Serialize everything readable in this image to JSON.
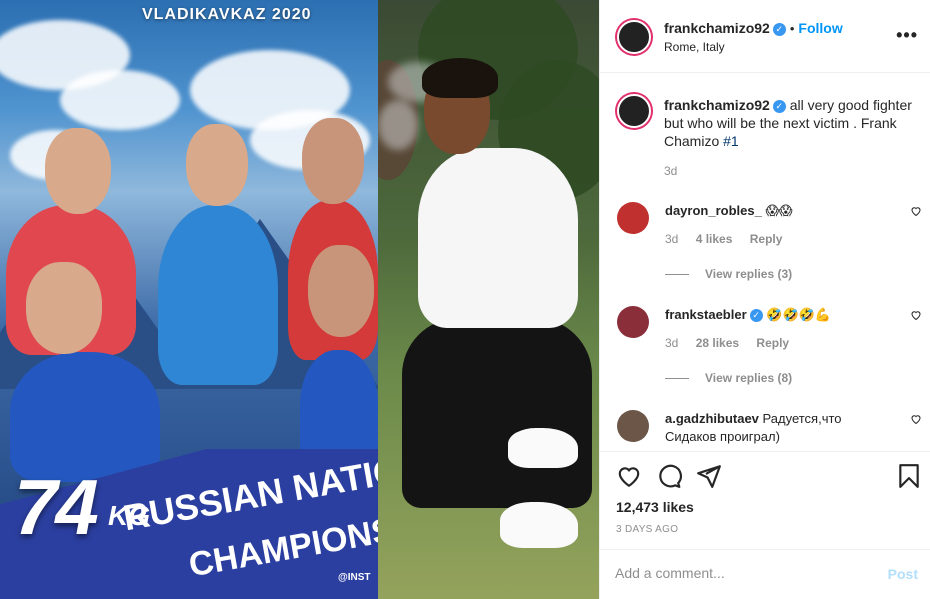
{
  "post": {
    "poster_title": "VLADIKAVKAZ 2020",
    "poster_weight": "74",
    "poster_unit": "KG",
    "poster_line1": "RUSSIAN NATIO",
    "poster_line2": "CHAMPIONS",
    "poster_handle": "@INST"
  },
  "header": {
    "username": "frankchamizo92",
    "verified_glyph": "✓",
    "separator": "•",
    "follow_label": "Follow",
    "location": "Rome, Italy",
    "more_glyph": "•••"
  },
  "caption": {
    "username": "frankchamizo92",
    "verified_glyph": "✓",
    "text": " all very good fighter but who will be the next victim . Frank Chamizo ",
    "hashtag": "#1",
    "time": "3d"
  },
  "comments": [
    {
      "username": "dayron_robles_",
      "text": " 😱😱",
      "time": "3d",
      "likes": "4 likes",
      "reply": "Reply",
      "view_replies": "View replies (3)"
    },
    {
      "username": "frankstaebler",
      "verified_glyph": "✓",
      "text": " 🤣🤣🤣💪",
      "time": "3d",
      "likes": "28 likes",
      "reply": "Reply",
      "view_replies": "View replies (8)"
    },
    {
      "username": "a.gadzhibutaev",
      "text": " Радуется,что Сидаков проиграл)"
    }
  ],
  "actions": {
    "likes": "12,473 likes",
    "posted_ago": "3 DAYS AGO"
  },
  "add_comment": {
    "placeholder": "Add a comment...",
    "post_label": "Post"
  },
  "colors": {
    "link_blue": "#0095f6",
    "verified_blue": "#3897f0",
    "muted": "#8e8e8e",
    "post_disabled": "#b2dffc"
  },
  "icons": [
    "heart-icon",
    "comment-icon",
    "share-icon",
    "bookmark-icon",
    "more-options-icon",
    "verified-icon"
  ]
}
